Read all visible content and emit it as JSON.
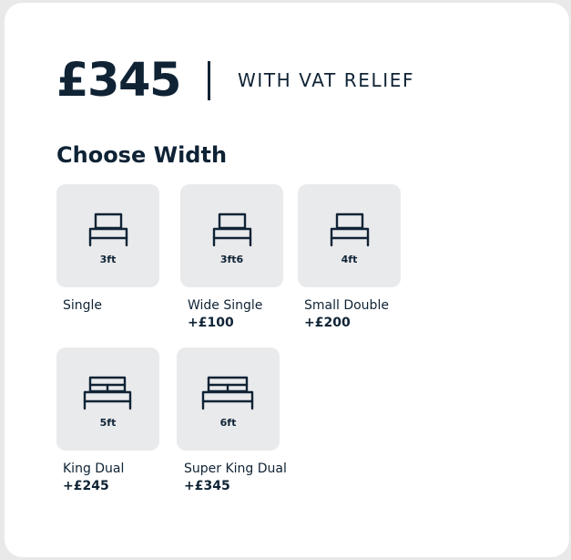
{
  "header": {
    "price": "£345",
    "vat_label": "WITH VAT RELIEF"
  },
  "section": {
    "title": "Choose Width"
  },
  "options": [
    {
      "size": "3ft",
      "name": "Single",
      "price": "",
      "icon": "single-bed-icon"
    },
    {
      "size": "3ft6",
      "name": "Wide Single",
      "price": "+£100",
      "icon": "single-bed-icon"
    },
    {
      "size": "4ft",
      "name": "Small Double",
      "price": "+£200",
      "icon": "single-bed-icon"
    },
    {
      "size": "5ft",
      "name": "King Dual",
      "price": "+£245",
      "icon": "double-bed-icon"
    },
    {
      "size": "6ft",
      "name": "Super King Dual",
      "price": "+£345",
      "icon": "double-bed-icon"
    }
  ]
}
